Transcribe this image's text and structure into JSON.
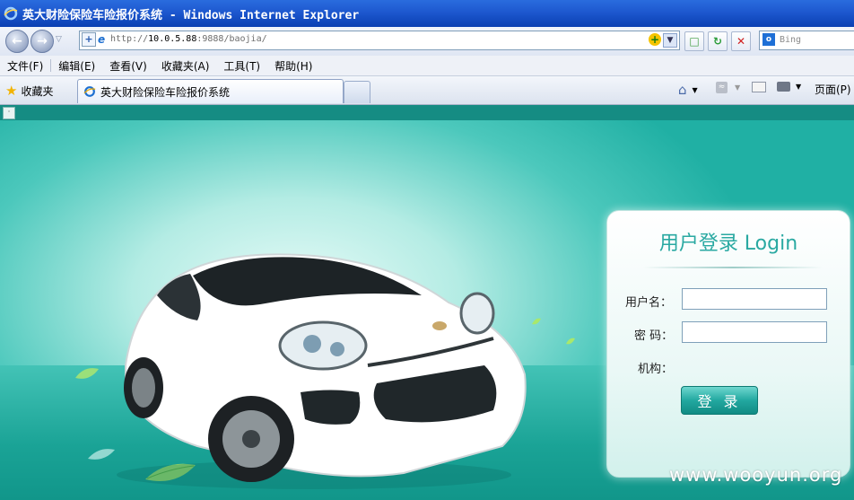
{
  "window": {
    "title_cn": "英大财险保险车险报价系统",
    "title_sep": " - ",
    "title_app": "Windows Internet Explorer"
  },
  "address": {
    "url_scheme": "http://",
    "url_host": "10.0.5.88",
    "url_rest": ":9888/baojia/",
    "search_placeholder": "Bing"
  },
  "menu": {
    "items": [
      "文件(F)",
      "编辑(E)",
      "查看(V)",
      "收藏夹(A)",
      "工具(T)",
      "帮助(H)"
    ]
  },
  "tabs": {
    "favorites_label": "收藏夹",
    "active_tab_label": "英大财险保险车险报价系统",
    "page_label": "页面(P)"
  },
  "login": {
    "title": "用户登录 Login",
    "username_label": "用户名：",
    "password_label": "密 码：",
    "org_label": "机构：",
    "username_value": "",
    "password_value": "",
    "submit_label": "登 录"
  },
  "watermark": "www.wooyun.org",
  "colors": {
    "accent": "#2aa9a2",
    "titlebar": "#1d58cf",
    "background": "#1aa79e"
  }
}
